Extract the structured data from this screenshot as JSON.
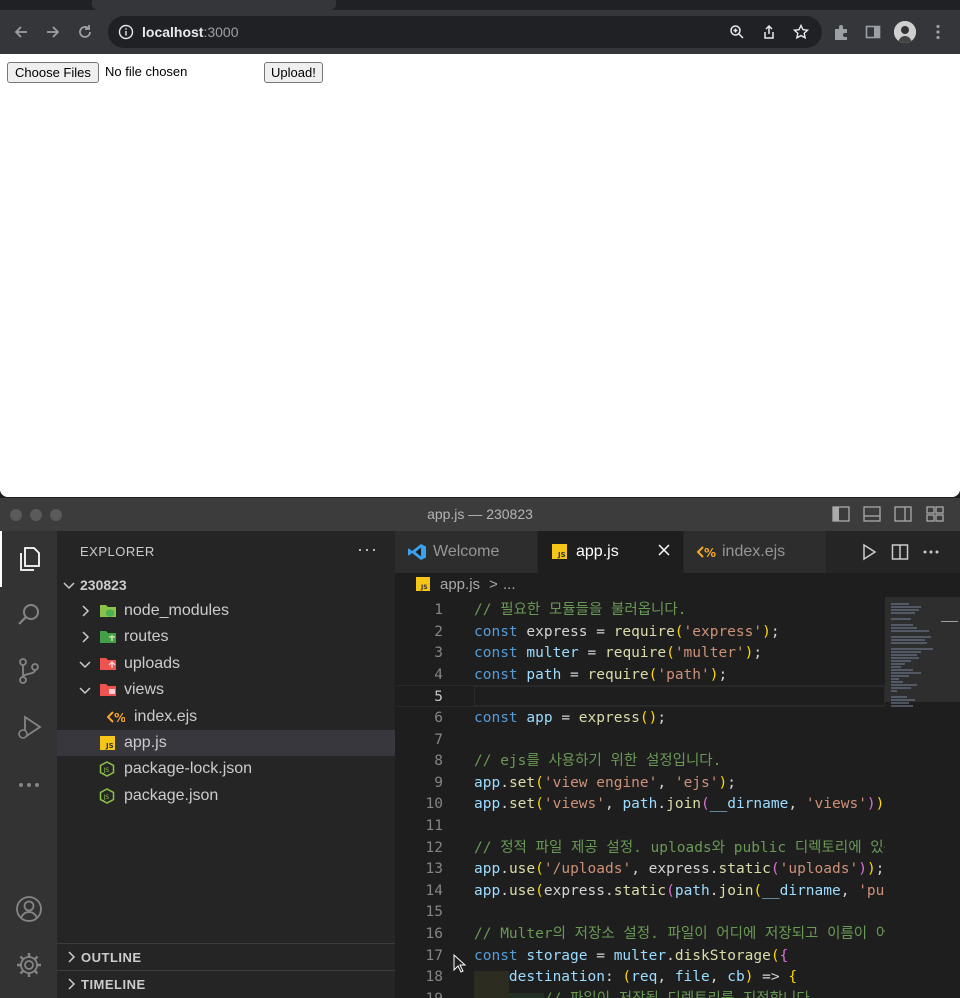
{
  "browser": {
    "url_host": "localhost",
    "url_port": ":3000",
    "page": {
      "choose_files_label": "Choose Files",
      "file_status": "No file chosen",
      "upload_label": "Upload!"
    }
  },
  "vscode": {
    "window_title": "app.js — 230823",
    "explorer": {
      "title": "EXPLORER",
      "more": "···",
      "root": "230823",
      "items": [
        {
          "label": "node_modules",
          "type": "folder",
          "expanded": false
        },
        {
          "label": "routes",
          "type": "folder",
          "expanded": false
        },
        {
          "label": "uploads",
          "type": "folder",
          "expanded": true
        },
        {
          "label": "views",
          "type": "folder",
          "expanded": true
        },
        {
          "label": "index.ejs",
          "type": "ejs"
        },
        {
          "label": "app.js",
          "type": "js",
          "selected": true
        },
        {
          "label": "package-lock.json",
          "type": "json"
        },
        {
          "label": "package.json",
          "type": "json"
        }
      ],
      "outline_label": "OUTLINE",
      "timeline_label": "TIMELINE"
    },
    "tabs": [
      {
        "label": "Welcome",
        "active": false
      },
      {
        "label": "app.js",
        "active": true
      },
      {
        "label": "index.ejs",
        "active": false
      }
    ],
    "breadcrumb": {
      "file": "app.js",
      "separator": ">",
      "more": "..."
    },
    "code_lines": [
      {
        "n": "1",
        "text": "// 필요한 모듈들을 불러옵니다."
      },
      {
        "n": "2",
        "text": "const express = require('express');"
      },
      {
        "n": "3",
        "text": "const multer = require('multer');"
      },
      {
        "n": "4",
        "text": "const path = require('path');"
      },
      {
        "n": "5",
        "text": ""
      },
      {
        "n": "6",
        "text": "const app = express();"
      },
      {
        "n": "7",
        "text": ""
      },
      {
        "n": "8",
        "text": "// ejs를 사용하기 위한 설정입니다."
      },
      {
        "n": "9",
        "text": "app.set('view engine', 'ejs');"
      },
      {
        "n": "10",
        "text": "app.set('views', path.join(__dirname, 'views'));"
      },
      {
        "n": "11",
        "text": ""
      },
      {
        "n": "12",
        "text": "// 정적 파일 제공 설정. uploads와 public 디렉토리에 있는"
      },
      {
        "n": "13",
        "text": "app.use('/uploads', express.static('uploads'));"
      },
      {
        "n": "14",
        "text": "app.use(express.static(path.join(__dirname, 'pub"
      },
      {
        "n": "15",
        "text": ""
      },
      {
        "n": "16",
        "text": "// Multer의 저장소 설정. 파일이 어디에 저장되고 이름이 어떻게"
      },
      {
        "n": "17",
        "text": "const storage = multer.diskStorage({"
      },
      {
        "n": "18",
        "text": "    destination: (req, file, cb) => {"
      },
      {
        "n": "19",
        "text": "        // 파일이 저장될 디렉토리를 지정합니다."
      }
    ],
    "current_line": "5"
  }
}
